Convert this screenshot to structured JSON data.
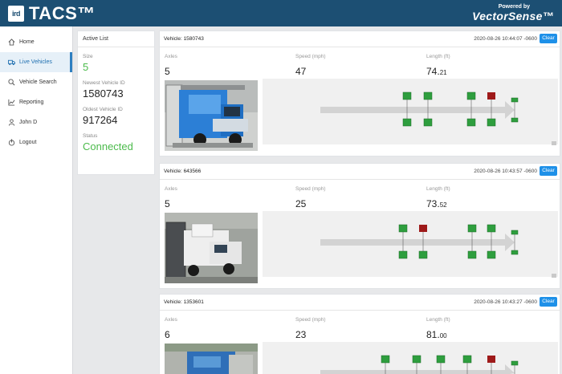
{
  "header": {
    "logo_text": "ird",
    "app_title": "TACS™",
    "powered_by": "Powered by",
    "brand": "VectorSense™"
  },
  "sidebar": {
    "items": [
      {
        "label": "Home",
        "icon": "home-icon",
        "active": false
      },
      {
        "label": "Live Vehicles",
        "icon": "truck-icon",
        "active": true
      },
      {
        "label": "Vehicle Search",
        "icon": "search-icon",
        "active": false
      },
      {
        "label": "Reporting",
        "icon": "chart-icon",
        "active": false
      },
      {
        "label": "John D",
        "icon": "user-icon",
        "active": false
      },
      {
        "label": "Logout",
        "icon": "logout-icon",
        "active": false
      }
    ]
  },
  "active_list": {
    "title": "Active List",
    "size_label": "Size",
    "size_value": "5",
    "newest_label": "Newest Vehicle ID",
    "newest_value": "1580743",
    "oldest_label": "Oldest Vehicle ID",
    "oldest_value": "917264",
    "status_label": "Status",
    "status_value": "Connected"
  },
  "labels": {
    "axles": "Axles",
    "speed": "Speed (mph)",
    "length": "Length (ft)",
    "clear": "Clear"
  },
  "vehicles": [
    {
      "title": "Vehicle: 1580743",
      "time": "2020-08-26 10:44:07 -0600",
      "axles": "5",
      "speed": "47",
      "length_int": "74.",
      "length_dec": "21"
    },
    {
      "title": "Vehicle: 643566",
      "time": "2020-08-26 10:43:57 -0600",
      "axles": "5",
      "speed": "25",
      "length_int": "73.",
      "length_dec": "52"
    },
    {
      "title": "Vehicle: 1353601",
      "time": "2020-08-26 10:43:27 -0600",
      "axles": "6",
      "speed": "23",
      "length_int": "81.",
      "length_dec": "00"
    }
  ],
  "colors": {
    "header_bg": "#1c4f73",
    "accent": "#1e90e8",
    "status_ok": "#4cbb4c",
    "axle_ok": "#2e9e3e",
    "axle_alert": "#9e1a1a"
  }
}
